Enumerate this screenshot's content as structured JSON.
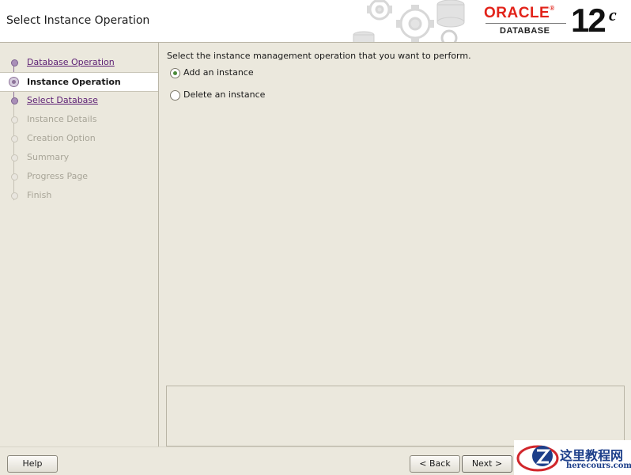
{
  "header": {
    "title": "Select Instance Operation",
    "brand": "ORACLE",
    "product": "DATABASE",
    "version": "12",
    "version_suffix": "c"
  },
  "nav": {
    "steps": [
      {
        "label": "Database Operation",
        "state": "done"
      },
      {
        "label": "Instance Operation",
        "state": "current"
      },
      {
        "label": "Select Database",
        "state": "done"
      },
      {
        "label": "Instance Details",
        "state": "pending"
      },
      {
        "label": "Creation Option",
        "state": "pending"
      },
      {
        "label": "Summary",
        "state": "pending"
      },
      {
        "label": "Progress Page",
        "state": "pending"
      },
      {
        "label": "Finish",
        "state": "pending"
      }
    ]
  },
  "main": {
    "prompt": "Select the instance management operation that you want to perform.",
    "options": [
      {
        "label": "Add an instance",
        "checked": true
      },
      {
        "label": "Delete an instance",
        "checked": false
      }
    ]
  },
  "buttons": {
    "help": "Help",
    "back": "< Back",
    "next": "Next >"
  },
  "watermark": {
    "text": "这里教程网",
    "url": "herecours.com"
  },
  "colors": {
    "brand_red": "#e2231a",
    "link_purple": "#5b1d73",
    "panel_bg": "#ebe8dd",
    "radio_selected": "#4a8a3a"
  }
}
